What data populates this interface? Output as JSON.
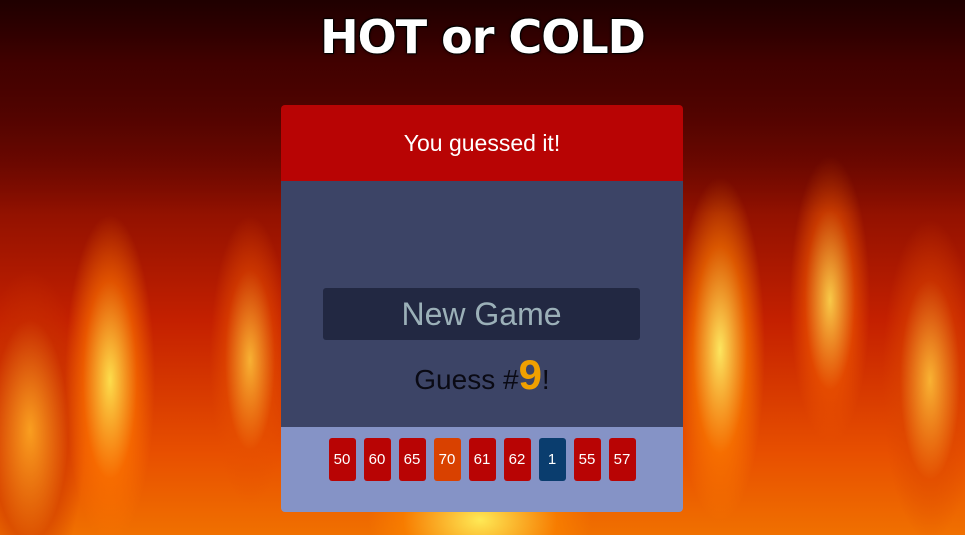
{
  "title": "HOT or COLD",
  "feedback": "You guessed it!",
  "new_game_label": "New Game",
  "guess": {
    "prefix": "Guess #",
    "number": "9",
    "suffix": "!"
  },
  "colors": {
    "hot": "#b80404",
    "warm": "#d94100",
    "cold": "#0a3d6e"
  },
  "guesses": [
    {
      "value": "50",
      "heat": "hot"
    },
    {
      "value": "60",
      "heat": "hot"
    },
    {
      "value": "65",
      "heat": "hot"
    },
    {
      "value": "70",
      "heat": "warm"
    },
    {
      "value": "61",
      "heat": "hot"
    },
    {
      "value": "62",
      "heat": "hot"
    },
    {
      "value": "1",
      "heat": "cold"
    },
    {
      "value": "55",
      "heat": "hot"
    },
    {
      "value": "57",
      "heat": "hot"
    }
  ]
}
